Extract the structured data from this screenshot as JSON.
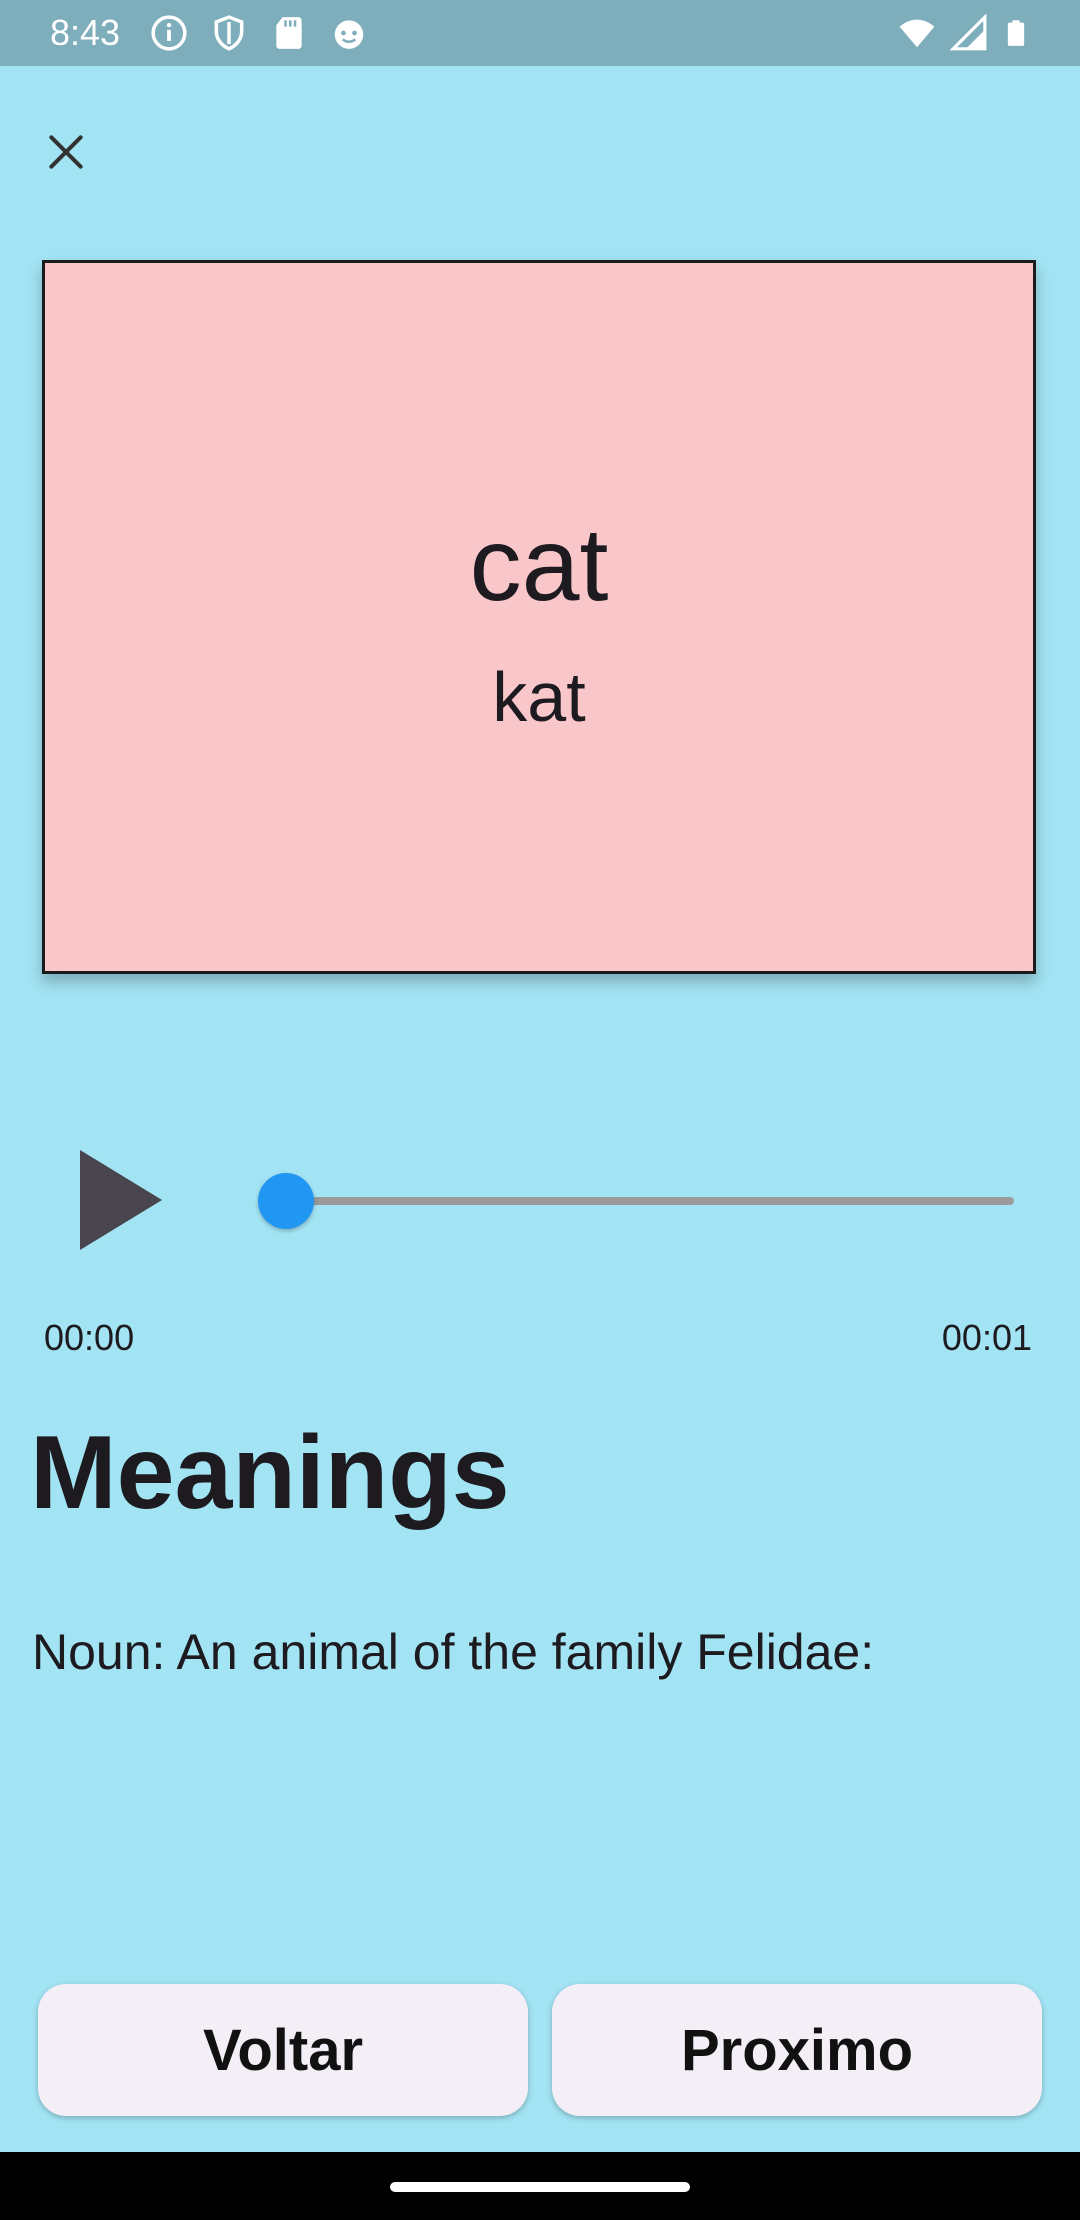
{
  "status_bar": {
    "time": "8:43",
    "icons_left": [
      "info-icon",
      "shield-icon",
      "sd-card-icon",
      "android-icon"
    ],
    "icons_right": [
      "wifi-icon",
      "signal-icon",
      "battery-icon"
    ]
  },
  "flashcard": {
    "word": "cat",
    "phonetic": "kat",
    "background": "#f9c7ca"
  },
  "player": {
    "progress_fraction": 0.0,
    "current_time": "00:00",
    "total_time": "00:01",
    "accent": "#2196f3"
  },
  "meanings": {
    "title": "Meanings",
    "text": "Noun: An animal of the family Felidae:"
  },
  "actions": {
    "back_label": "Voltar",
    "next_label": "Proximo"
  }
}
